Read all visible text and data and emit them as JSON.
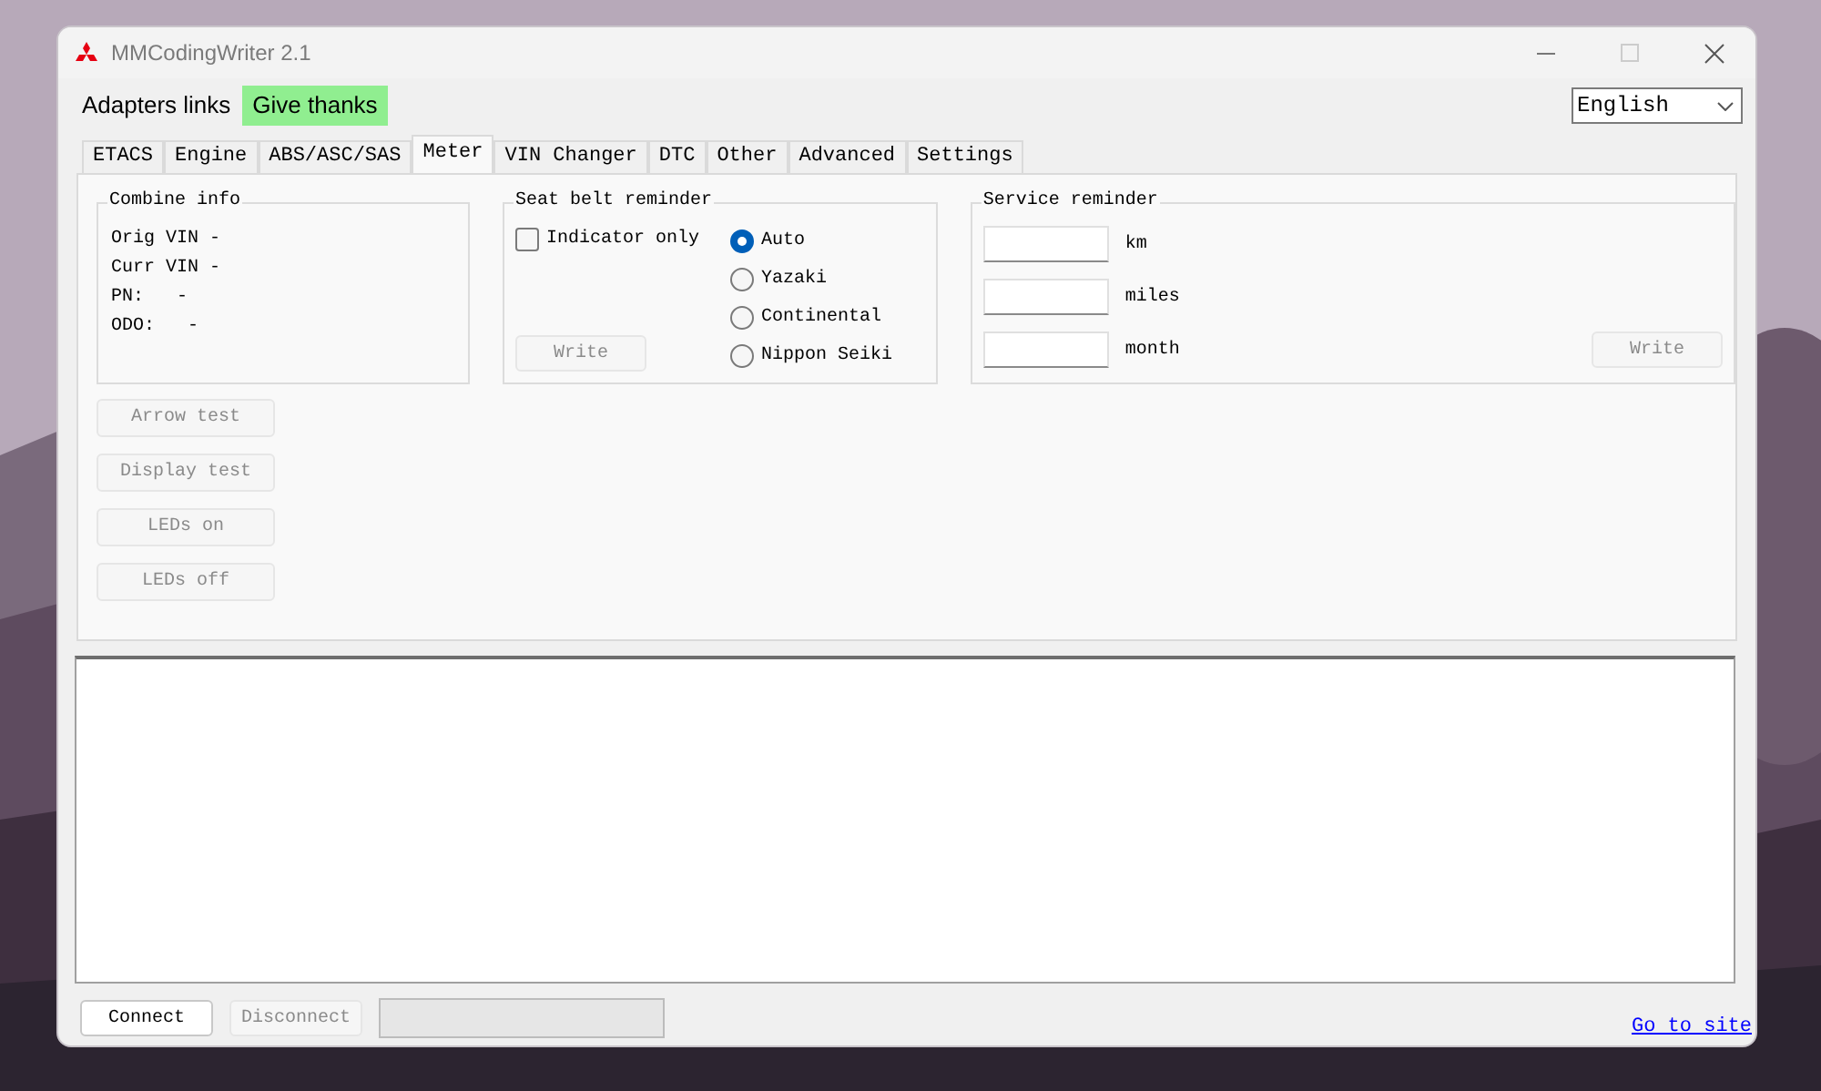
{
  "window": {
    "title": "MMCodingWriter 2.1"
  },
  "menu": [
    {
      "label": "Adapters links",
      "kind": "plain"
    },
    {
      "label": "Give thanks",
      "kind": "highlight"
    }
  ],
  "language": {
    "value": "English"
  },
  "tabs": [
    {
      "label": "ETACS",
      "selected": false
    },
    {
      "label": "Engine",
      "selected": false
    },
    {
      "label": "ABS/ASC/SAS",
      "selected": false
    },
    {
      "label": "Meter",
      "selected": true
    },
    {
      "label": "VIN Changer",
      "selected": false
    },
    {
      "label": "DTC",
      "selected": false
    },
    {
      "label": "Other",
      "selected": false
    },
    {
      "label": "Advanced",
      "selected": false
    },
    {
      "label": "Settings",
      "selected": false
    }
  ],
  "combine_info": {
    "title": "Combine info",
    "lines": [
      "Orig VIN -",
      "Curr VIN -",
      "PN:   -",
      "ODO:   -"
    ]
  },
  "test_buttons": [
    {
      "label": "Arrow test",
      "disabled": true
    },
    {
      "label": "Display test",
      "disabled": true
    },
    {
      "label": "LEDs on",
      "disabled": true
    },
    {
      "label": "LEDs off",
      "disabled": true
    }
  ],
  "seat_belt": {
    "title": "Seat belt reminder",
    "checkbox": {
      "label": "Indicator only",
      "checked": false
    },
    "write": {
      "label": "Write",
      "disabled": true
    },
    "options": [
      {
        "label": "Auto",
        "selected": true
      },
      {
        "label": "Yazaki",
        "selected": false
      },
      {
        "label": "Continental",
        "selected": false
      },
      {
        "label": "Nippon Seiki",
        "selected": false
      }
    ]
  },
  "service": {
    "title": "Service reminder",
    "fields": [
      {
        "unit": "km"
      },
      {
        "unit": "miles"
      },
      {
        "unit": "month"
      }
    ],
    "write": {
      "label": "Write",
      "disabled": true
    }
  },
  "bottom": {
    "buttons": [
      {
        "label": "Connect",
        "disabled": false
      },
      {
        "label": "Disconnect",
        "disabled": true
      }
    ],
    "link": "Go to site"
  }
}
